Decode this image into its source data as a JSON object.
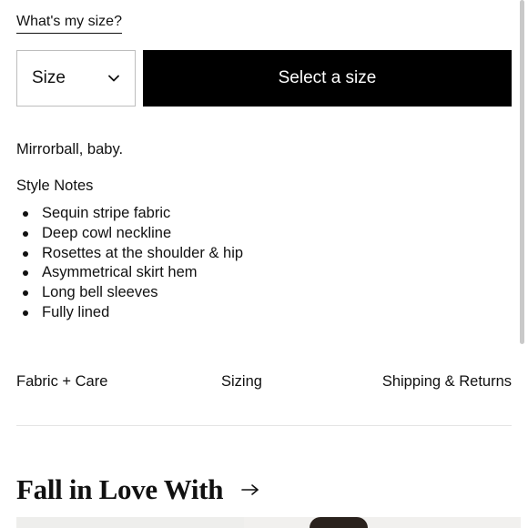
{
  "size_help": {
    "link_label": "What's my size?"
  },
  "size_selector": {
    "label": "Size",
    "icon": "chevron-down-icon"
  },
  "primary_action": {
    "label": "Select a size"
  },
  "description": {
    "tagline": "Mirrorball, baby."
  },
  "style_notes": {
    "title": "Style Notes",
    "items": [
      "Sequin stripe fabric",
      "Deep cowl neckline",
      "Rosettes at the shoulder & hip",
      "Asymmetrical skirt hem",
      "Long bell sleeves",
      "Fully lined"
    ]
  },
  "info_tabs": [
    {
      "label": "Fabric + Care"
    },
    {
      "label": "Sizing"
    },
    {
      "label": "Shipping & Returns"
    }
  ],
  "recommendations": {
    "title": "Fall in Love With",
    "icon": "arrow-right-icon"
  },
  "colors": {
    "button_bg": "#000000",
    "button_text": "#ffffff",
    "divider": "#e4e4e4",
    "select_border": "#bdbdbd"
  }
}
